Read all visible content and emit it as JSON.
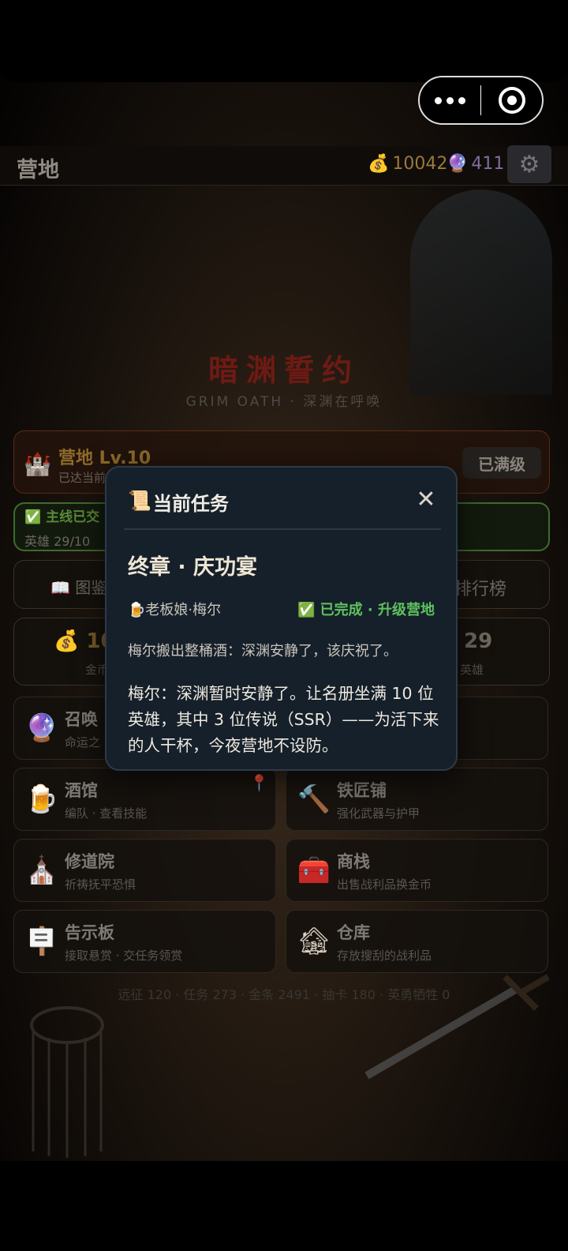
{
  "header": {
    "title": "营地",
    "gold": "10042",
    "gems": "411"
  },
  "brand": {
    "title": "暗渊誓约",
    "tagline": "GRIM OATH · 深渊在呼唤"
  },
  "camp": {
    "name": "营地 Lv.10",
    "subtitle": "已达当前",
    "max_label": "已满级"
  },
  "main_quest": {
    "line1": "✅ 主线已交",
    "line2": "英雄 29/10"
  },
  "tabs": {
    "left": "图鉴",
    "right": "排行榜"
  },
  "stats": {
    "gold_value": "10",
    "gold_label": "金币",
    "hero_value": "29",
    "hero_label": "英雄"
  },
  "menu": [
    {
      "title": "召唤",
      "subtitle": "命运之",
      "icon": "crystal-ball-icon"
    },
    {
      "title": "",
      "subtitle": "",
      "icon": ""
    },
    {
      "title": "酒馆",
      "subtitle": "编队 · 查看技能",
      "icon": "beer-mug-icon"
    },
    {
      "title": "铁匠铺",
      "subtitle": "强化武器与护甲",
      "icon": "hammer-icon"
    },
    {
      "title": "修道院",
      "subtitle": "祈祷抚平恐惧",
      "icon": "church-icon"
    },
    {
      "title": "商栈",
      "subtitle": "出售战利品换金币",
      "icon": "shop-chest-icon"
    },
    {
      "title": "告示板",
      "subtitle": "接取悬赏 · 交任务领赏",
      "icon": "signboard-icon"
    },
    {
      "title": "仓库",
      "subtitle": "存放搜刮的战利品",
      "icon": "warehouse-icon"
    }
  ],
  "footer_stats": "远征 120 · 任务 273 · 金条 2491 · 抽卡 180 · 英勇牺牲 0",
  "modal": {
    "title": "当前任务",
    "chapter": "终章 · 庆功宴",
    "npc": "老板娘·梅尔",
    "status": "✅ 已完成 · 升级营地",
    "intro": "梅尔搬出整桶酒：深渊安静了，该庆祝了。",
    "body": "梅尔：深渊暂时安静了。让名册坐满 10 位英雄，其中 3 位传说（SSR）——为活下来的人干杯，今夜营地不设防。"
  }
}
